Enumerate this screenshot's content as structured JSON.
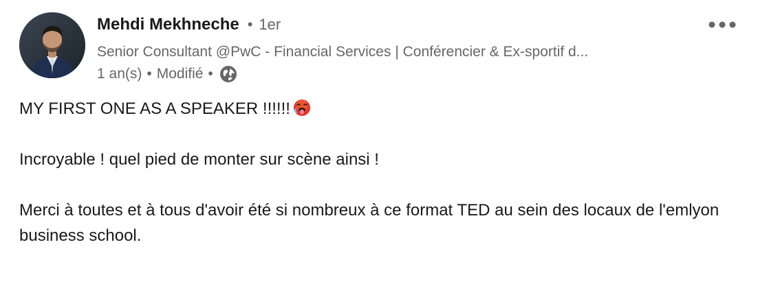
{
  "post": {
    "author": {
      "name": "Mehdi Mekhneche",
      "separator": "•",
      "degree": "1er",
      "headline": "Senior Consultant @PwC - Financial Services | Conférencier & Ex-sportif d...",
      "time": "1 an(s)",
      "meta_separator": "•",
      "edited": "Modifié",
      "visibility_icon": "globe-icon",
      "avatar_icon": "profile-photo"
    },
    "menu_icon": "more-horizontal-icon",
    "text": {
      "line1": "MY FIRST ONE AS A SPEAKER !!!!!!",
      "line1_emoji": "hot-face-emoji",
      "line2": "Incroyable ! quel pied de monter sur scène ainsi !",
      "line3": "Merci à toutes et à tous d'avoir été si nombreux à ce format TED au sein des locaux de l'emlyon business school."
    },
    "colors": {
      "primary_text": "#191919",
      "secondary_text": "#666666",
      "emoji_face": "#e0352b"
    }
  }
}
